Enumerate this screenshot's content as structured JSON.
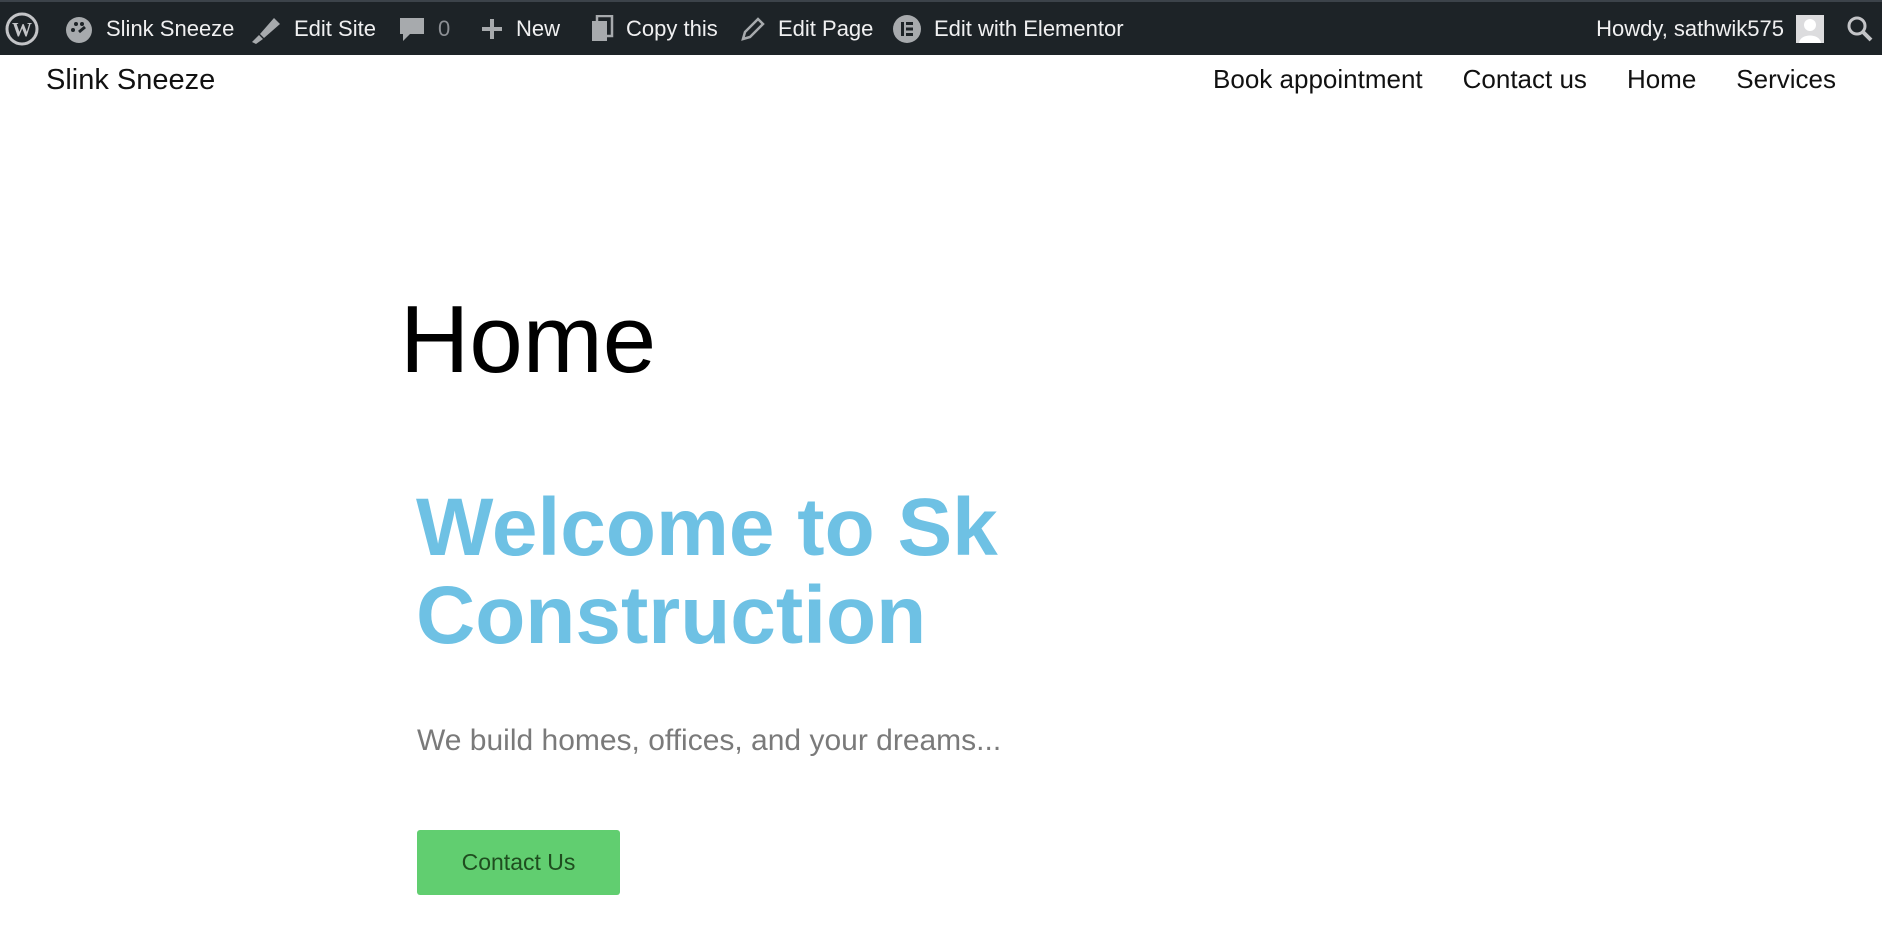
{
  "adminbar": {
    "site_name": "Slink Sneeze",
    "edit_site": "Edit Site",
    "comments_count": "0",
    "new_label": "New",
    "copy_this": "Copy this",
    "edit_page": "Edit Page",
    "edit_elementor": "Edit with Elementor",
    "howdy": "Howdy, sathwik575",
    "icons": [
      "wordpress-logo-icon",
      "dashboard-icon",
      "brush-icon",
      "comment-icon",
      "plus-icon",
      "copy-icon",
      "pencil-icon",
      "elementor-icon",
      "avatar-icon",
      "search-icon"
    ],
    "bg_color": "#1d2327"
  },
  "header": {
    "site_title": "Slink Sneeze",
    "nav": [
      "Book appointment",
      "Contact us",
      "Home",
      "Services"
    ]
  },
  "main": {
    "page_title": "Home",
    "hero_heading": "Welcome to Sk Construction",
    "hero_sub": "We build homes, offices, and your dreams...",
    "cta_label": "Contact Us",
    "accent_color": "#6ec1e4",
    "button_color": "#61ce70"
  }
}
